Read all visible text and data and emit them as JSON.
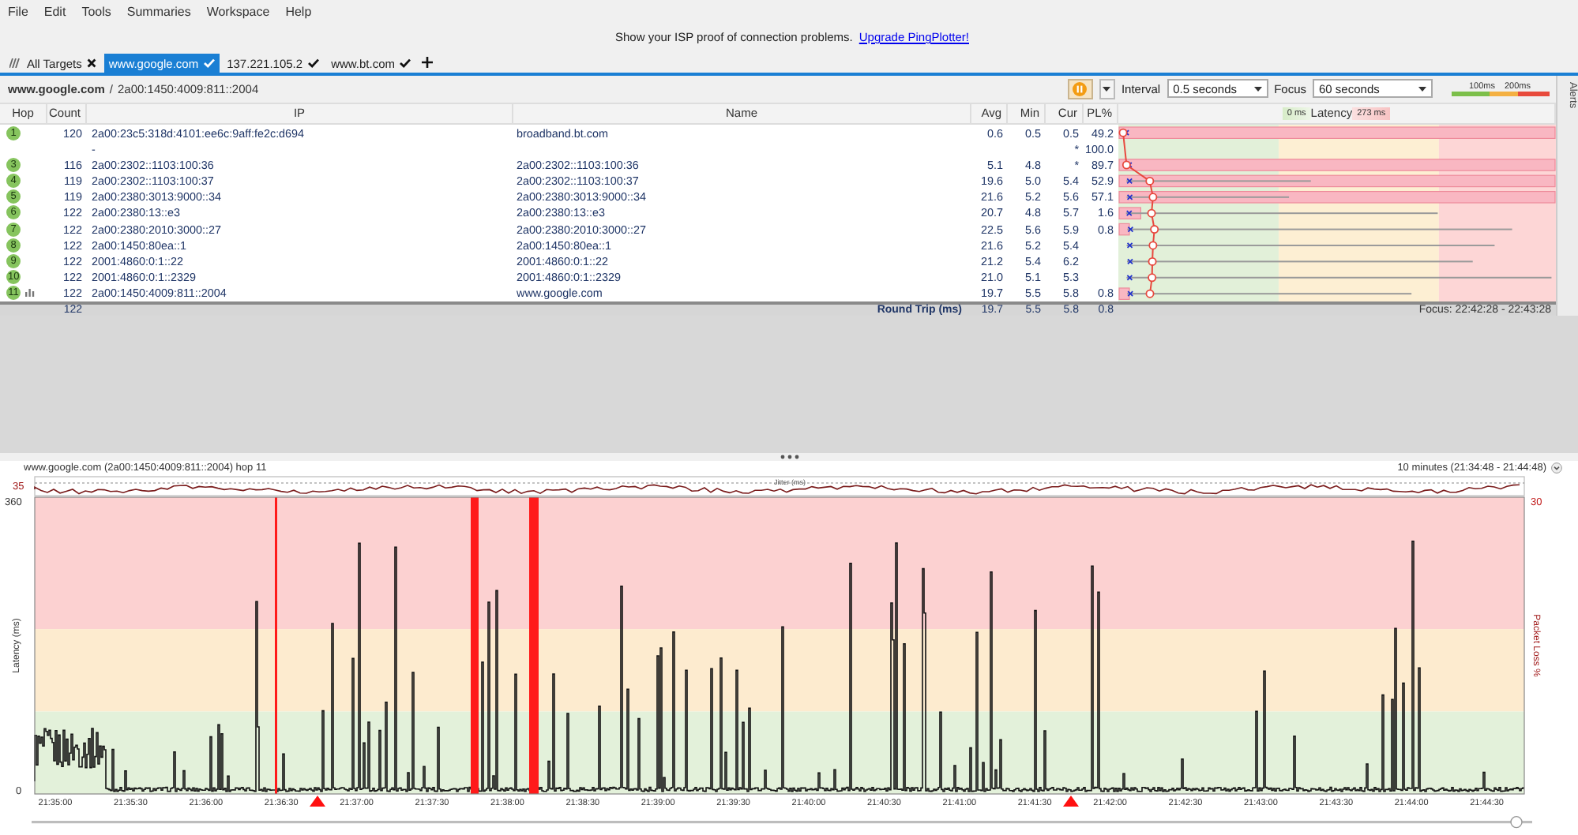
{
  "menu": [
    "File",
    "Edit",
    "Tools",
    "Summaries",
    "Workspace",
    "Help"
  ],
  "banner": {
    "text": "Show your ISP proof of connection problems.",
    "link": "Upgrade PingPlotter!"
  },
  "tabs": [
    {
      "label": "All Targets",
      "kind": "all",
      "selected": false
    },
    {
      "label": "www.google.com",
      "kind": "target",
      "selected": true
    },
    {
      "label": "137.221.105.2",
      "kind": "target",
      "selected": false
    },
    {
      "label": "www.bt.com",
      "kind": "target",
      "selected": false
    }
  ],
  "breadcrumb": {
    "target": "www.google.com",
    "separator": "/",
    "ip": "2a00:1450:4009:811::2004"
  },
  "controls": {
    "interval": {
      "label": "Interval",
      "value": "0.5 seconds"
    },
    "focus": {
      "label": "Focus",
      "value": "60 seconds"
    },
    "scale": [
      "100ms",
      "200ms"
    ]
  },
  "alerts_tab": "Alerts",
  "table": {
    "columns": [
      "Hop",
      "Count",
      "IP",
      "Name",
      "Avg",
      "Min",
      "Cur",
      "PL%"
    ],
    "latency_header": {
      "min": "0 ms",
      "title": "Latency",
      "max": "273 ms"
    },
    "rows": [
      {
        "hop": "1",
        "count": "120",
        "ip": "2a00:23c5:318d:4101:ee6c:9aff:fe2c:d694",
        "name": "broadband.bt.com",
        "avg": "0.6",
        "min": "0.5",
        "cur": "0.5",
        "pl": "49.2",
        "graphed": false,
        "level": 1
      },
      {
        "ip": "-",
        "cur": "*",
        "pl": "100.0",
        "graphed": false
      },
      {
        "hop": "3",
        "count": "116",
        "ip": "2a00:2302::1103:100:36",
        "name": "2a00:2302::1103:100:36",
        "avg": "5.1",
        "min": "4.8",
        "cur": "*",
        "pl": "89.7",
        "graphed": false,
        "level": 1
      },
      {
        "hop": "4",
        "count": "119",
        "ip": "2a00:2302::1103:100:37",
        "name": "2a00:2302::1103:100:37",
        "avg": "19.6",
        "min": "5.0",
        "cur": "5.4",
        "pl": "52.9",
        "graphed": false,
        "level": 1,
        "whisker": {
          "level": 0.44
        }
      },
      {
        "hop": "5",
        "count": "119",
        "ip": "2a00:2380:3013:9000::34",
        "name": "2a00:2380:3013:9000::34",
        "avg": "21.6",
        "min": "5.2",
        "cur": "5.6",
        "pl": "57.1",
        "graphed": false,
        "level": 1,
        "whisker": {
          "level": 0.39
        }
      },
      {
        "hop": "6",
        "count": "122",
        "ip": "2a00:2380:13::e3",
        "name": "2a00:2380:13::e3",
        "avg": "20.7",
        "min": "4.8",
        "cur": "5.7",
        "pl": "1.6",
        "graphed": false,
        "level": 0.053,
        "whisker": {
          "level": 0.73
        }
      },
      {
        "hop": "7",
        "count": "122",
        "ip": "2a00:2380:2010:3000::27",
        "name": "2a00:2380:2010:3000::27",
        "avg": "22.5",
        "min": "5.6",
        "cur": "5.9",
        "pl": "0.8",
        "graphed": false,
        "level": 0.027,
        "whisker": {
          "level": 0.9
        }
      },
      {
        "hop": "8",
        "count": "122",
        "ip": "2a00:1450:80ea::1",
        "name": "2a00:1450:80ea::1",
        "avg": "21.6",
        "min": "5.2",
        "cur": "5.4",
        "graphed": false,
        "whisker": {
          "level": 0.86
        }
      },
      {
        "hop": "9",
        "count": "122",
        "ip": "2001:4860:0:1::22",
        "name": "2001:4860:0:1::22",
        "avg": "21.2",
        "min": "5.4",
        "cur": "6.2",
        "graphed": false,
        "whisker": {
          "level": 0.81
        }
      },
      {
        "hop": "10",
        "count": "122",
        "ip": "2001:4860:0:1::2329",
        "name": "2001:4860:0:1::2329",
        "avg": "21.0",
        "min": "5.1",
        "cur": "5.3",
        "graphed": false,
        "whisker": {
          "level": 0.99
        }
      },
      {
        "hop": "11",
        "count": "122",
        "ip": "2a00:1450:4009:811::2004",
        "name": "www.google.com",
        "avg": "19.7",
        "min": "5.5",
        "cur": "5.8",
        "pl": "0.8",
        "graphed": true,
        "level": 0.027,
        "whisker": {
          "level": 0.67
        }
      }
    ],
    "footer": {
      "count": "122",
      "label": "Round Trip (ms)",
      "avg": "19.7",
      "min": "5.5",
      "cur": "5.8",
      "pl": "0.8",
      "focus": "Focus: 22:42:28 - 22:43:28"
    }
  },
  "graph": {
    "title": "www.google.com (2a00:1450:4009:811::2004) hop 11",
    "range": "10 minutes (21:34:48 - 21:44:48)",
    "jitter_max": "35",
    "jitter_label": "Jitter (ms)",
    "y_max": "360",
    "y_min": "0",
    "y_label": "Latency (ms)",
    "loss_max": "30",
    "loss_label": "Packet Loss %",
    "x_labels": [
      "21:35:00",
      "21:35:30",
      "21:36:00",
      "21:36:30",
      "21:37:00",
      "21:37:30",
      "21:38:00",
      "21:38:30",
      "21:39:00",
      "21:39:30",
      "21:40:00",
      "21:40:30",
      "21:41:00",
      "21:41:30",
      "21:42:00",
      "21:42:30",
      "21:43:00",
      "21:43:30",
      "21:44:00",
      "21:44:30"
    ]
  }
}
